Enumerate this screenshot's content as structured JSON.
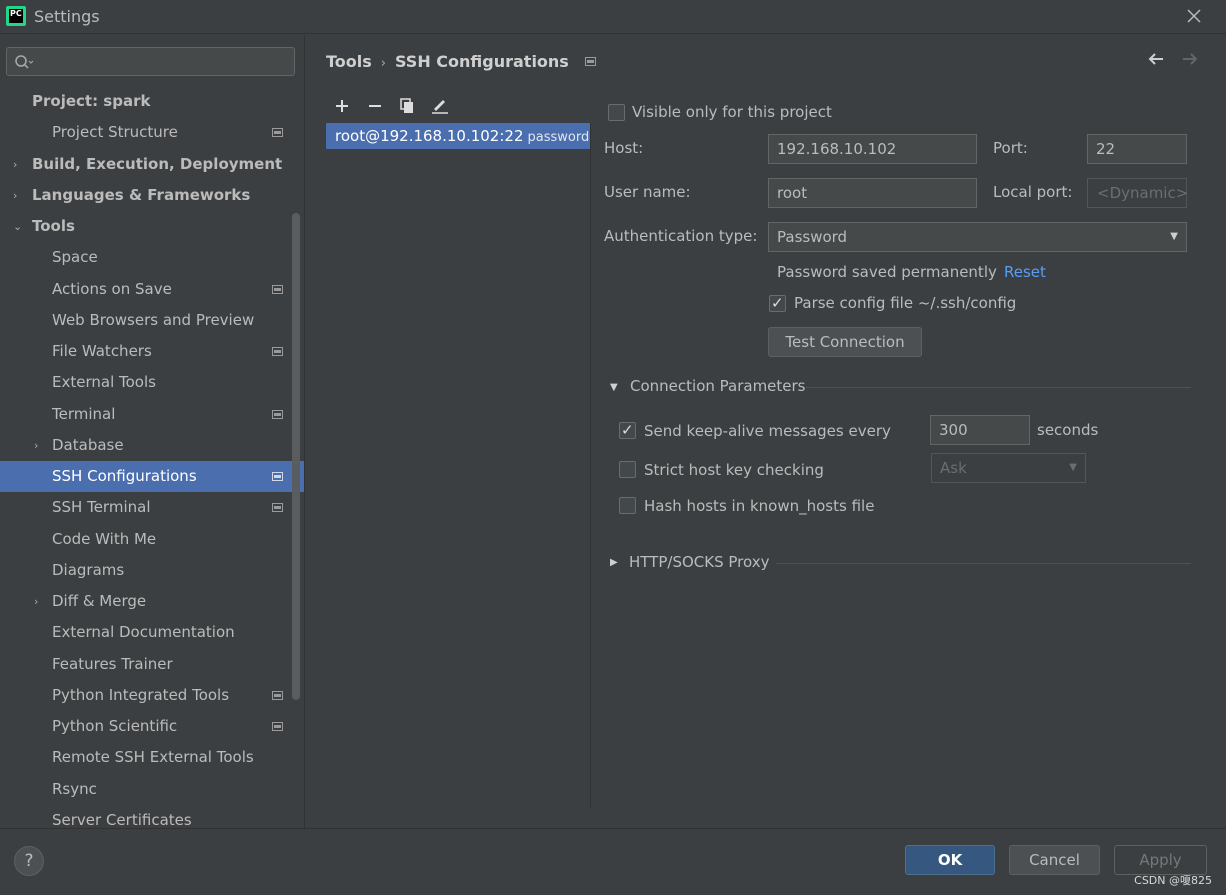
{
  "window": {
    "title": "Settings",
    "app_icon": "PC"
  },
  "search": {
    "placeholder": ""
  },
  "tree": [
    {
      "label": "Project: spark",
      "level": 0,
      "arrow": "",
      "proj_icon": false
    },
    {
      "label": "Project Structure",
      "level": 1,
      "arrow": "",
      "proj_icon": true
    },
    {
      "label": "Build, Execution, Deployment",
      "level": 0,
      "arrow": "›",
      "proj_icon": false
    },
    {
      "label": "Languages & Frameworks",
      "level": 0,
      "arrow": "›",
      "proj_icon": false
    },
    {
      "label": "Tools",
      "level": 0,
      "arrow": "⌄",
      "proj_icon": false
    },
    {
      "label": "Space",
      "level": 1,
      "arrow": "",
      "proj_icon": false
    },
    {
      "label": "Actions on Save",
      "level": 1,
      "arrow": "",
      "proj_icon": true
    },
    {
      "label": "Web Browsers and Preview",
      "level": 1,
      "arrow": "",
      "proj_icon": false
    },
    {
      "label": "File Watchers",
      "level": 1,
      "arrow": "",
      "proj_icon": true
    },
    {
      "label": "External Tools",
      "level": 1,
      "arrow": "",
      "proj_icon": false
    },
    {
      "label": "Terminal",
      "level": 1,
      "arrow": "",
      "proj_icon": true
    },
    {
      "label": "Database",
      "level": 1,
      "arrow": "›",
      "proj_icon": false
    },
    {
      "label": "SSH Configurations",
      "level": 1,
      "arrow": "",
      "proj_icon": true,
      "selected": true
    },
    {
      "label": "SSH Terminal",
      "level": 1,
      "arrow": "",
      "proj_icon": true
    },
    {
      "label": "Code With Me",
      "level": 1,
      "arrow": "",
      "proj_icon": false
    },
    {
      "label": "Diagrams",
      "level": 1,
      "arrow": "",
      "proj_icon": false
    },
    {
      "label": "Diff & Merge",
      "level": 1,
      "arrow": "›",
      "proj_icon": false
    },
    {
      "label": "External Documentation",
      "level": 1,
      "arrow": "",
      "proj_icon": false
    },
    {
      "label": "Features Trainer",
      "level": 1,
      "arrow": "",
      "proj_icon": false
    },
    {
      "label": "Python Integrated Tools",
      "level": 1,
      "arrow": "",
      "proj_icon": true
    },
    {
      "label": "Python Scientific",
      "level": 1,
      "arrow": "",
      "proj_icon": true
    },
    {
      "label": "Remote SSH External Tools",
      "level": 1,
      "arrow": "",
      "proj_icon": false
    },
    {
      "label": "Rsync",
      "level": 1,
      "arrow": "",
      "proj_icon": false
    },
    {
      "label": "Server Certificates",
      "level": 1,
      "arrow": "",
      "proj_icon": false
    }
  ],
  "breadcrumb": {
    "parent": "Tools",
    "sep": "›",
    "current": "SSH Configurations"
  },
  "connections": [
    {
      "name": "root@192.168.10.102:22",
      "auth": "password"
    }
  ],
  "form": {
    "visible_only_label": "Visible only for this project",
    "visible_only_checked": false,
    "host_label": "Host:",
    "host_value": "192.168.10.102",
    "port_label": "Port:",
    "port_value": "22",
    "username_label": "User name:",
    "username_value": "root",
    "local_port_label": "Local port:",
    "local_port_placeholder": "<Dynamic>",
    "auth_type_label": "Authentication type:",
    "auth_type_value": "Password",
    "password_saved_text": "Password saved permanently",
    "reset_link": "Reset",
    "parse_config_label": "Parse config file ~/.ssh/config",
    "parse_config_checked": true,
    "test_connection_label": "Test Connection"
  },
  "connection_params": {
    "title": "Connection Parameters",
    "keepalive_label": "Send keep-alive messages every",
    "keepalive_checked": true,
    "keepalive_value": "300",
    "keepalive_unit": "seconds",
    "strict_label": "Strict host key checking",
    "strict_checked": false,
    "strict_value": "Ask",
    "hash_label": "Hash hosts in known_hosts file",
    "hash_checked": false
  },
  "proxy": {
    "title": "HTTP/SOCKS Proxy"
  },
  "footer": {
    "help": "?",
    "ok": "OK",
    "cancel": "Cancel",
    "apply": "Apply",
    "watermark": "CSDN @嗄825"
  },
  "colors": {
    "selection": "#4b6eaf",
    "link": "#589df6",
    "ok_button": "#365880"
  }
}
